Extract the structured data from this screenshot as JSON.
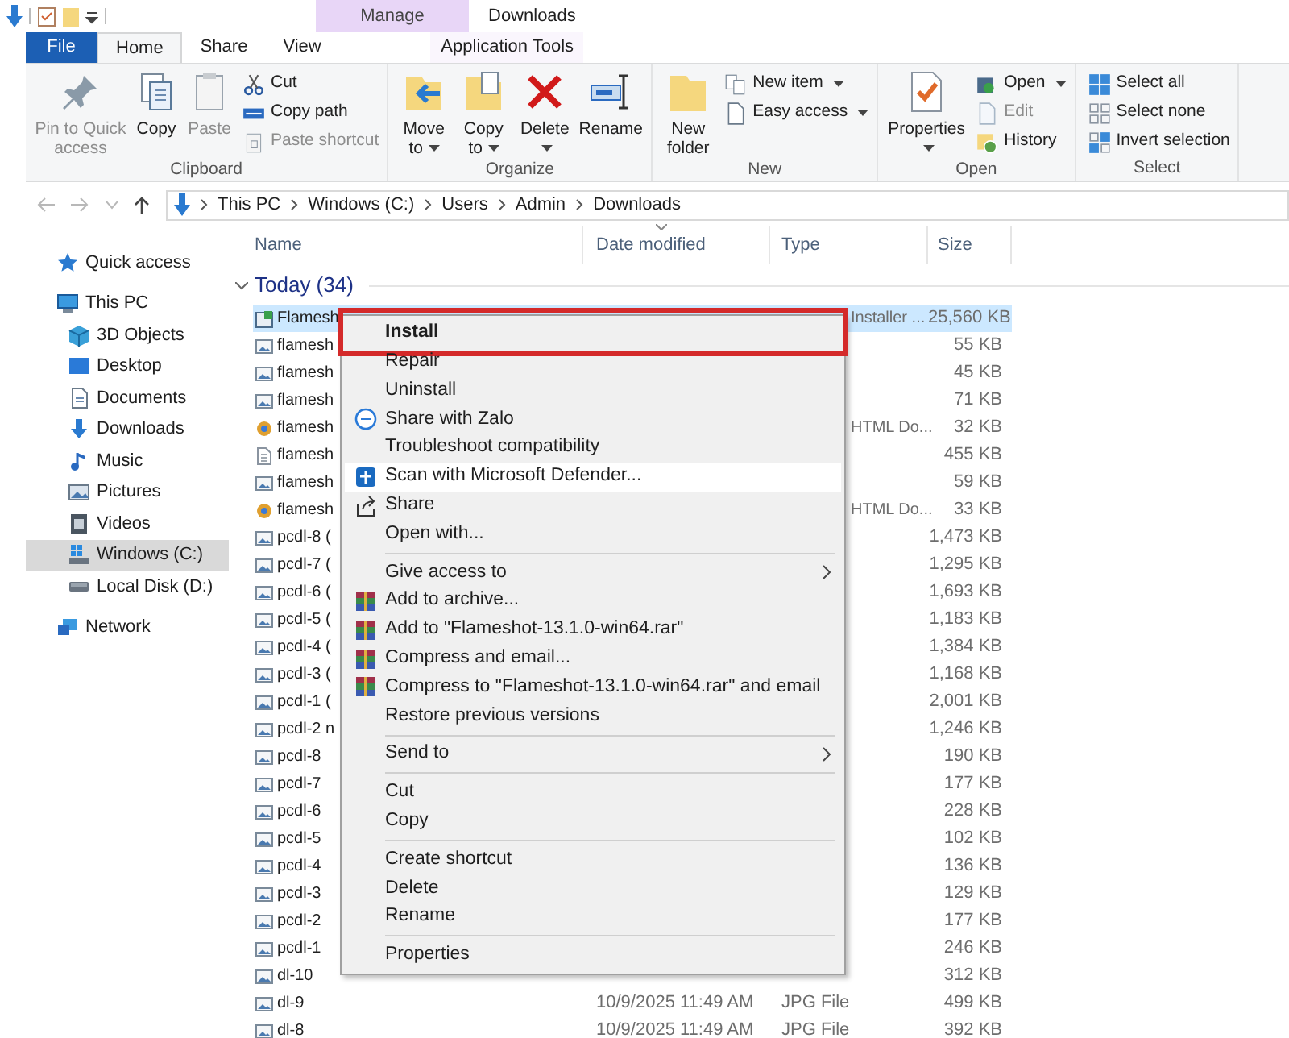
{
  "title_bar": {
    "contextual_header": "Manage",
    "title": "Downloads"
  },
  "ribbon_tabs": [
    {
      "label": "File",
      "kind": "file",
      "selected": false
    },
    {
      "label": "Home",
      "kind": "tab",
      "selected": true
    },
    {
      "label": "Share",
      "kind": "tab",
      "selected": false
    },
    {
      "label": "View",
      "kind": "tab",
      "selected": false
    },
    {
      "label": "Application Tools",
      "kind": "contextual",
      "selected": false
    }
  ],
  "ribbon_groups": [
    {
      "label": "Clipboard",
      "large": [
        {
          "label": "Pin to Quick access",
          "disabled": true,
          "dropdown": false
        },
        {
          "label": "Copy",
          "disabled": false,
          "dropdown": false
        },
        {
          "label": "Paste",
          "disabled": true,
          "dropdown": false
        }
      ],
      "small": [
        {
          "label": "Cut",
          "disabled": false,
          "dropdown": false
        },
        {
          "label": "Copy path",
          "disabled": false,
          "dropdown": false
        },
        {
          "label": "Paste shortcut",
          "disabled": true,
          "dropdown": false
        }
      ]
    },
    {
      "label": "Organize",
      "large": [
        {
          "label": "Move to",
          "disabled": false,
          "dropdown": true
        },
        {
          "label": "Copy to",
          "disabled": false,
          "dropdown": true
        },
        {
          "label": "Delete",
          "disabled": false,
          "dropdown": true
        },
        {
          "label": "Rename",
          "disabled": false,
          "dropdown": false
        }
      ]
    },
    {
      "label": "New",
      "large": [
        {
          "label": "New folder",
          "disabled": false,
          "dropdown": false
        }
      ],
      "small": [
        {
          "label": "New item",
          "disabled": false,
          "dropdown": true
        },
        {
          "label": "Easy access",
          "disabled": false,
          "dropdown": true
        }
      ]
    },
    {
      "label": "Open",
      "large": [
        {
          "label": "Properties",
          "disabled": false,
          "dropdown": true
        }
      ],
      "small": [
        {
          "label": "Open",
          "disabled": false,
          "dropdown": true
        },
        {
          "label": "Edit",
          "disabled": true,
          "dropdown": false
        },
        {
          "label": "History",
          "disabled": false,
          "dropdown": false
        }
      ]
    },
    {
      "label": "Select",
      "small": [
        {
          "label": "Select all",
          "disabled": false,
          "dropdown": false
        },
        {
          "label": "Select none",
          "disabled": false,
          "dropdown": false
        },
        {
          "label": "Invert selection",
          "disabled": false,
          "dropdown": false
        }
      ]
    }
  ],
  "address": {
    "crumbs": [
      "This PC",
      "Windows (C:)",
      "Users",
      "Admin",
      "Downloads"
    ]
  },
  "sidebar": {
    "items": [
      {
        "label": "Quick access",
        "selected": false
      },
      {
        "label": "This PC",
        "selected": false,
        "children": [
          {
            "label": "3D Objects",
            "selected": false
          },
          {
            "label": "Desktop",
            "selected": false
          },
          {
            "label": "Documents",
            "selected": false
          },
          {
            "label": "Downloads",
            "selected": false
          },
          {
            "label": "Music",
            "selected": false
          },
          {
            "label": "Pictures",
            "selected": false
          },
          {
            "label": "Videos",
            "selected": false
          },
          {
            "label": "Windows (C:)",
            "selected": true
          },
          {
            "label": "Local Disk (D:)",
            "selected": false
          }
        ]
      },
      {
        "label": "Network",
        "selected": false
      }
    ]
  },
  "columns": [
    {
      "label": "Name",
      "sorted": false
    },
    {
      "label": "Date modified",
      "sorted": true
    },
    {
      "label": "Type",
      "sorted": false
    },
    {
      "label": "Size",
      "sorted": false
    }
  ],
  "group": {
    "label": "Today (34)",
    "expanded": true
  },
  "rows": [
    {
      "name": "Flamesh",
      "selected": true,
      "type": "Installer ...",
      "size": "25,560 KB"
    },
    {
      "name": "flamesh",
      "selected": false,
      "size": "55 KB"
    },
    {
      "name": "flamesh",
      "selected": false,
      "size": "45 KB"
    },
    {
      "name": "flamesh",
      "selected": false,
      "size": "71 KB"
    },
    {
      "name": "flamesh",
      "selected": false,
      "type": "HTML Do...",
      "size": "32 KB"
    },
    {
      "name": "flamesh",
      "selected": false,
      "size": "455 KB"
    },
    {
      "name": "flamesh",
      "selected": false,
      "size": "59 KB"
    },
    {
      "name": "flamesh",
      "selected": false,
      "type": "HTML Do...",
      "size": "33 KB"
    },
    {
      "name": "pcdl-8 (",
      "selected": false,
      "size": "1,473 KB"
    },
    {
      "name": "pcdl-7 (",
      "selected": false,
      "size": "1,295 KB"
    },
    {
      "name": "pcdl-6 (",
      "selected": false,
      "size": "1,693 KB"
    },
    {
      "name": "pcdl-5 (",
      "selected": false,
      "size": "1,183 KB"
    },
    {
      "name": "pcdl-4 (",
      "selected": false,
      "size": "1,384 KB"
    },
    {
      "name": "pcdl-3 (",
      "selected": false,
      "size": "1,168 KB"
    },
    {
      "name": "pcdl-1 (",
      "selected": false,
      "size": "2,001 KB"
    },
    {
      "name": "pcdl-2 n",
      "selected": false,
      "size": "1,246 KB"
    },
    {
      "name": "pcdl-8",
      "selected": false,
      "size": "190 KB"
    },
    {
      "name": "pcdl-7",
      "selected": false,
      "size": "177 KB"
    },
    {
      "name": "pcdl-6",
      "selected": false,
      "size": "228 KB"
    },
    {
      "name": "pcdl-5",
      "selected": false,
      "size": "102 KB"
    },
    {
      "name": "pcdl-4",
      "selected": false,
      "size": "136 KB"
    },
    {
      "name": "pcdl-3",
      "selected": false,
      "size": "129 KB"
    },
    {
      "name": "pcdl-2",
      "selected": false,
      "size": "177 KB"
    },
    {
      "name": "pcdl-1",
      "selected": false,
      "size": "246 KB"
    },
    {
      "name": "dl-10",
      "selected": false,
      "size": "312 KB"
    },
    {
      "name": "dl-9",
      "selected": false,
      "date": "10/9/2025 11:49 AM",
      "type": "JPG File",
      "size": "499 KB"
    },
    {
      "name": "dl-8",
      "selected": false,
      "date": "10/9/2025 11:49 AM",
      "type": "JPG File",
      "size": "392 KB"
    }
  ],
  "context_menu": {
    "items": [
      {
        "kind": "item",
        "label": "Install",
        "default": true,
        "marked": true,
        "hovered": false
      },
      {
        "kind": "item",
        "label": "Repair",
        "hovered": false
      },
      {
        "kind": "item",
        "label": "Uninstall",
        "hovered": false
      },
      {
        "kind": "item",
        "label": "Share with Zalo",
        "hovered": false
      },
      {
        "kind": "item",
        "label": "Troubleshoot compatibility",
        "hovered": false
      },
      {
        "kind": "item",
        "label": "Scan with Microsoft Defender...",
        "hovered": true
      },
      {
        "kind": "item",
        "label": "Share",
        "hovered": false
      },
      {
        "kind": "item",
        "label": "Open with...",
        "hovered": false
      },
      {
        "kind": "separator"
      },
      {
        "kind": "item",
        "label": "Give access to",
        "submenu": true,
        "hovered": false
      },
      {
        "kind": "item",
        "label": "Add to archive...",
        "hovered": false
      },
      {
        "kind": "item",
        "label": "Add to \"Flameshot-13.1.0-win64.rar\"",
        "hovered": false
      },
      {
        "kind": "item",
        "label": "Compress and email...",
        "hovered": false
      },
      {
        "kind": "item",
        "label": "Compress to \"Flameshot-13.1.0-win64.rar\" and email",
        "hovered": false
      },
      {
        "kind": "item",
        "label": "Restore previous versions",
        "hovered": false
      },
      {
        "kind": "separator"
      },
      {
        "kind": "item",
        "label": "Send to",
        "submenu": true,
        "hovered": false
      },
      {
        "kind": "separator"
      },
      {
        "kind": "item",
        "label": "Cut",
        "hovered": false
      },
      {
        "kind": "item",
        "label": "Copy",
        "hovered": false
      },
      {
        "kind": "separator"
      },
      {
        "kind": "item",
        "label": "Create shortcut",
        "hovered": false
      },
      {
        "kind": "item",
        "label": "Delete",
        "hovered": false
      },
      {
        "kind": "item",
        "label": "Rename",
        "hovered": false
      },
      {
        "kind": "separator"
      },
      {
        "kind": "item",
        "label": "Properties",
        "hovered": false
      }
    ]
  }
}
